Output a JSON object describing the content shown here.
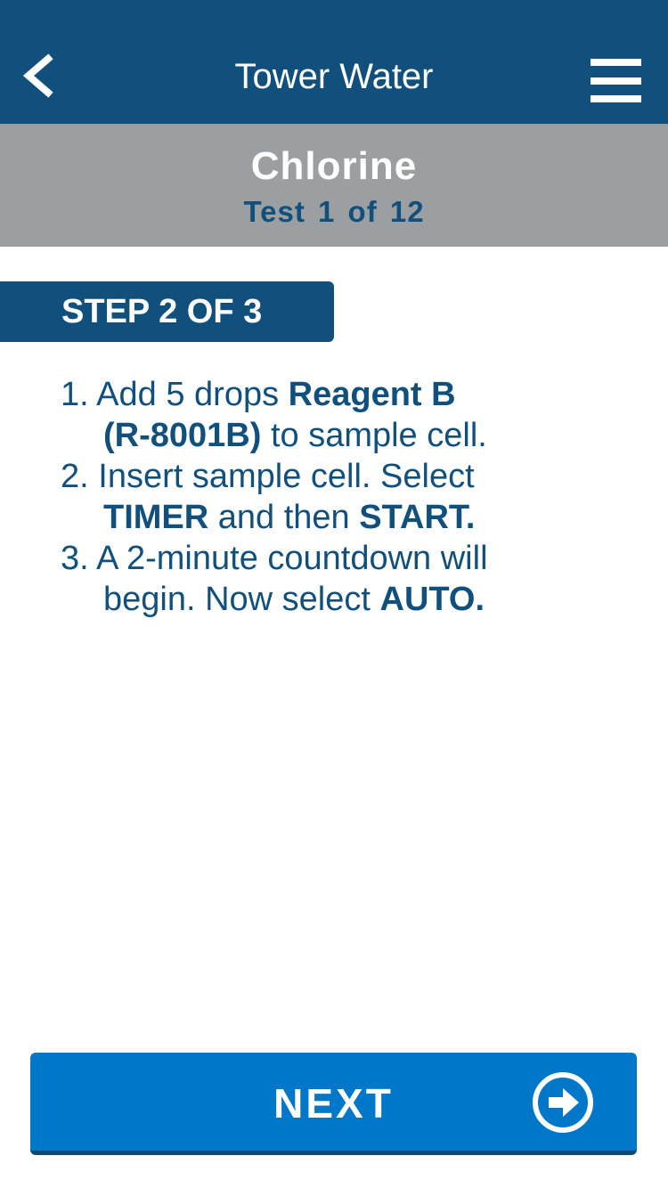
{
  "navbar": {
    "title": "Tower Water",
    "back_icon": "chevron-left-icon",
    "menu_icon": "hamburger-menu-icon"
  },
  "test": {
    "name": "Chlorine",
    "progress": "Test 1 of 12"
  },
  "step": {
    "label": "STEP 2 OF 3"
  },
  "instructions": [
    {
      "number": "1.",
      "segments": [
        {
          "text": "Add 5 drops ",
          "bold": false
        },
        {
          "text": "Reagent B",
          "bold": true
        }
      ],
      "segments_line2": [
        {
          "text": "(R-8001B)",
          "bold": true
        },
        {
          "text": " to sample cell.",
          "bold": false
        }
      ]
    },
    {
      "number": "2.",
      "segments": [
        {
          "text": "Insert sample cell. Select",
          "bold": false
        }
      ],
      "segments_line2": [
        {
          "text": "TIMER",
          "bold": true
        },
        {
          "text": " and then ",
          "bold": false
        },
        {
          "text": "START.",
          "bold": true
        }
      ]
    },
    {
      "number": "3.",
      "segments": [
        {
          "text": "A 2-minute countdown will",
          "bold": false
        }
      ],
      "segments_line2": [
        {
          "text": "begin. Now select ",
          "bold": false
        },
        {
          "text": "AUTO.",
          "bold": true
        }
      ]
    }
  ],
  "next_button": {
    "label": "NEXT",
    "icon": "arrow-right-circle-icon"
  },
  "colors": {
    "primary_navy": "#11507d",
    "header_gray": "#9b9fa1",
    "button_blue": "#0077c8"
  }
}
